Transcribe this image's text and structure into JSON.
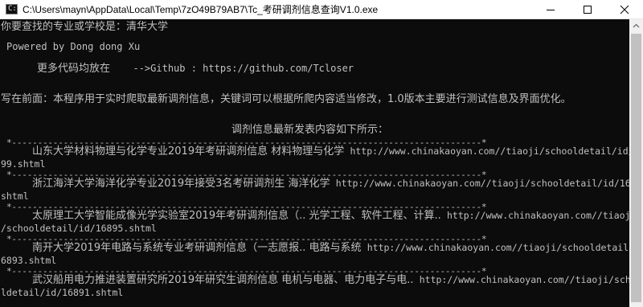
{
  "window": {
    "title": "C:\\Users\\mayn\\AppData\\Local\\Temp\\7zO49B79AB7\\Tc_考研调剂信息查询V1.0.exe",
    "icon_glyph": "C:\\"
  },
  "console": {
    "prompt_line": "你要查找的专业或学校是：清华大学",
    "powered_by": "Powered by Dong dong Xu",
    "github_prefix": "更多代码均放在",
    "github_text": "-->Github : https://github.com/Tcloser",
    "preface": "写在前面：本程序用于实时爬取最新调剂信息，关键词可以根据所爬内容适当修改，1.0版本主要进行测试信息及界面优化。",
    "list_heading": "调剂信息最新发表内容如下所示：",
    "separator": "*-------------------------------------------------------------------------------------------*",
    "entries": [
      {
        "title": "山东大学材料物理与化学专业2019年考研调剂信息 材料物理与化学",
        "url_line1": "http://www.chinakaoyan.com//tiaoji/schooldetail/id/168",
        "url_line2": "99.shtml"
      },
      {
        "title": "浙江海洋大学海洋化学专业2019年接受3名考研调剂生 海洋化学",
        "url_line1": "http://www.chinakaoyan.com//tiaoji/schooldetail/id/16897.",
        "url_line2": "shtml"
      },
      {
        "title": "太原理工大学智能成像光学实验室2019年考研调剂信息（.. 光学工程、软件工程、计算..",
        "url_line1": "http://www.chinakaoyan.com//tiaoji",
        "url_line2": "/schooldetail/id/16895.shtml"
      },
      {
        "title": "南开大学2019年电路与系统专业考研调剂信息（一志愿报.. 电路与系统",
        "url_line1": "http://www.chinakaoyan.com//tiaoji/schooldetail/id/1",
        "url_line2": "6893.shtml"
      },
      {
        "title": "武汉船用电力推进装置研究所2019年研究生调剂信息 电机与电器、电力电子与电..",
        "url_line1": "http://www.chinakaoyan.com//tiaoji/schoo",
        "url_line2": "ldetail/id/16891.shtml"
      }
    ]
  },
  "colors": {
    "console_bg": "#0c0c0c",
    "console_fg": "#c0c0c0",
    "titlebar_bg": "#ffffff",
    "scrollbar_track": "#f0f0f0",
    "scrollbar_thumb": "#c1c1c1"
  },
  "icons": {
    "app": "console-app-icon",
    "minimize": "minimize-icon",
    "maximize": "maximize-icon",
    "close": "close-icon",
    "scroll_up": "scroll-up-arrow-icon"
  }
}
